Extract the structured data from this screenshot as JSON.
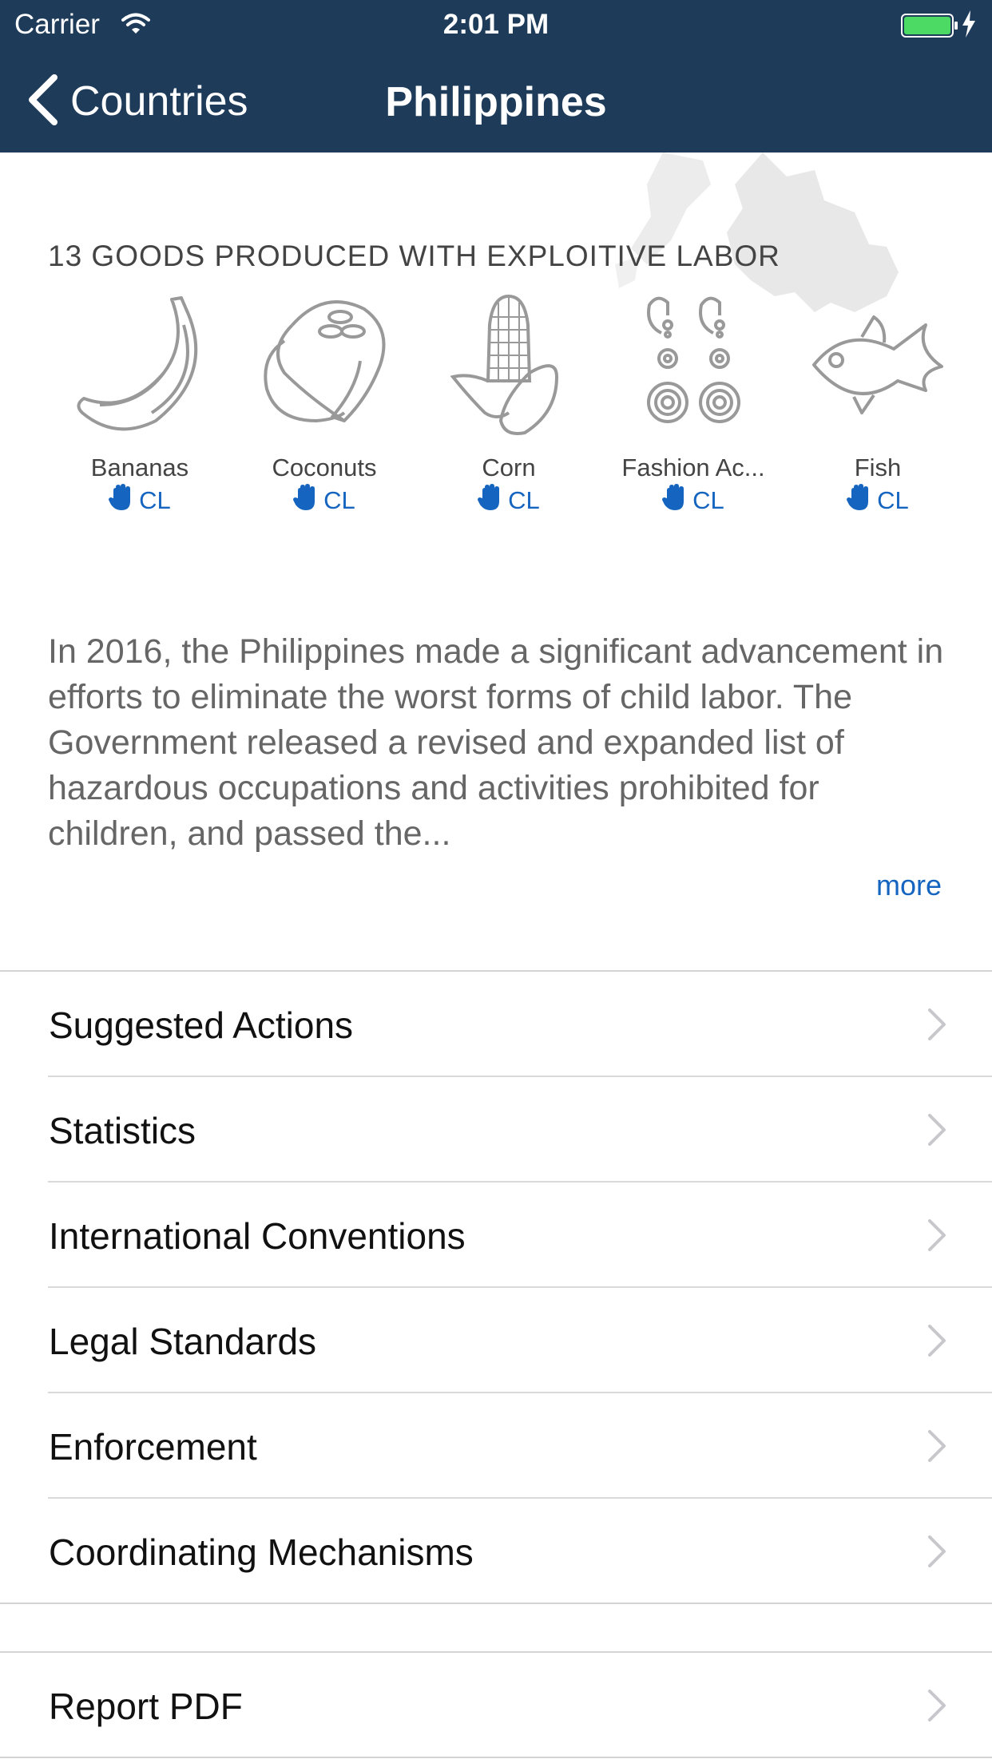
{
  "status_bar": {
    "carrier": "Carrier",
    "time": "2:01 PM",
    "battery_color": "#4cd964"
  },
  "nav": {
    "back_label": "Countries",
    "title": "Philippines",
    "background": "#1e3b5a"
  },
  "goods": {
    "heading": "13 GOODS PRODUCED WITH EXPLOITIVE LABOR",
    "items": [
      {
        "name": "Bananas",
        "tag": "CL",
        "icon": "banana-icon"
      },
      {
        "name": "Coconuts",
        "tag": "CL",
        "icon": "coconut-icon"
      },
      {
        "name": "Corn",
        "tag": "CL",
        "icon": "corn-icon"
      },
      {
        "name": "Fashion Ac...",
        "tag": "CL",
        "icon": "earrings-icon"
      },
      {
        "name": "Fish",
        "tag": "CL",
        "icon": "fish-icon"
      }
    ],
    "tag_icon": "hand-icon",
    "accent": "#1565c0"
  },
  "description": {
    "text": "In 2016, the Philippines made a significant advancement in efforts to eliminate the worst forms of child labor. The Government released a revised and expanded list of hazardous occupations and activities prohibited for children, and passed the...",
    "more_label": "more"
  },
  "menu": {
    "items": [
      {
        "label": "Suggested Actions"
      },
      {
        "label": "Statistics"
      },
      {
        "label": "International Conventions"
      },
      {
        "label": "Legal Standards"
      },
      {
        "label": "Enforcement"
      },
      {
        "label": "Coordinating Mechanisms"
      }
    ]
  },
  "report": {
    "label": "Report PDF"
  }
}
